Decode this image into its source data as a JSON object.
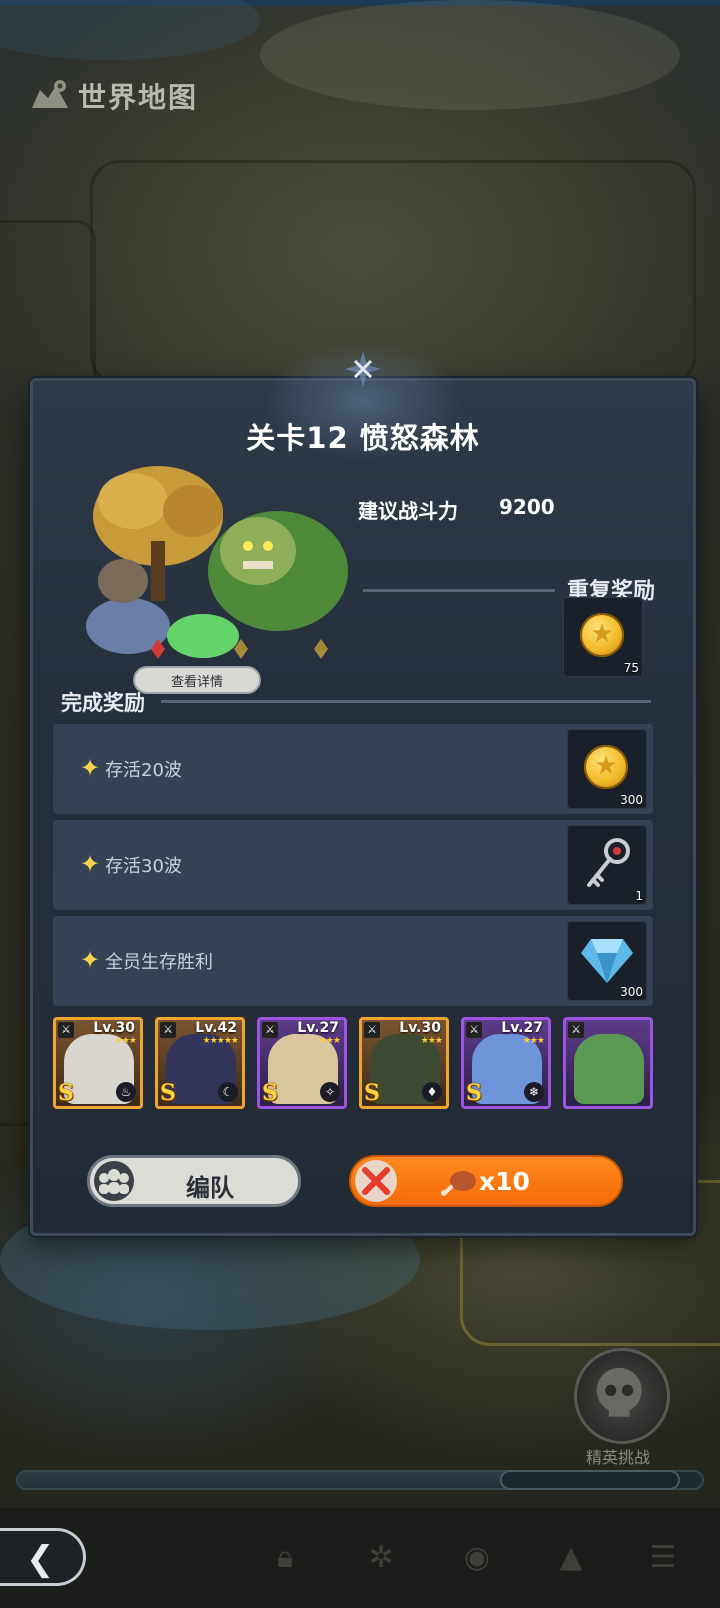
{
  "world_map": {
    "title": "世界地图"
  },
  "stage": {
    "title": "关卡12 愤怒森林",
    "detail_button": "查看详情",
    "power_label": "建议战斗力",
    "power_value": "9200"
  },
  "repeat_reward": {
    "label": "重复奖励",
    "item": {
      "icon": "gold-coin-icon",
      "qty": "75"
    }
  },
  "completion": {
    "label": "完成奖励",
    "tasks": [
      {
        "label": "存活20波",
        "reward_icon": "gold-coin-icon",
        "qty": "300"
      },
      {
        "label": "存活30波",
        "reward_icon": "key-icon",
        "qty": "1"
      },
      {
        "label": "全员生存胜利",
        "reward_icon": "diamond-icon",
        "qty": "300"
      }
    ]
  },
  "heroes": [
    {
      "level": "Lv.30",
      "stars": "★★★",
      "rank": "S",
      "frame": "gold",
      "element": "fire-icon",
      "color": "#d9d6cf"
    },
    {
      "level": "Lv.42",
      "stars": "★★★★★",
      "rank": "S",
      "frame": "gold",
      "element": "moon-icon",
      "color": "#33365a"
    },
    {
      "level": "Lv.27",
      "stars": "★★★",
      "rank": "S",
      "frame": "purple",
      "element": "light-icon",
      "color": "#d8c79c"
    },
    {
      "level": "Lv.30",
      "stars": "★★★",
      "rank": "S",
      "frame": "gold",
      "element": "blood-icon",
      "color": "#3c4a33"
    },
    {
      "level": "Lv.27",
      "stars": "★★★",
      "rank": "S",
      "frame": "purple",
      "element": "ice-icon",
      "color": "#6e95d9"
    },
    {
      "level": "",
      "stars": "",
      "rank": "",
      "frame": "purple",
      "element": "",
      "color": "#5a9a55"
    }
  ],
  "buttons": {
    "team": "编队",
    "fight_cost": "x10"
  },
  "elite": {
    "label": "精英挑战"
  },
  "map_progress": 0.72,
  "colors": {
    "accent_orange": "#f56a05",
    "panel": "#26303d",
    "gold_frame": "#f0a52e",
    "purple_frame": "#9b55e0"
  }
}
